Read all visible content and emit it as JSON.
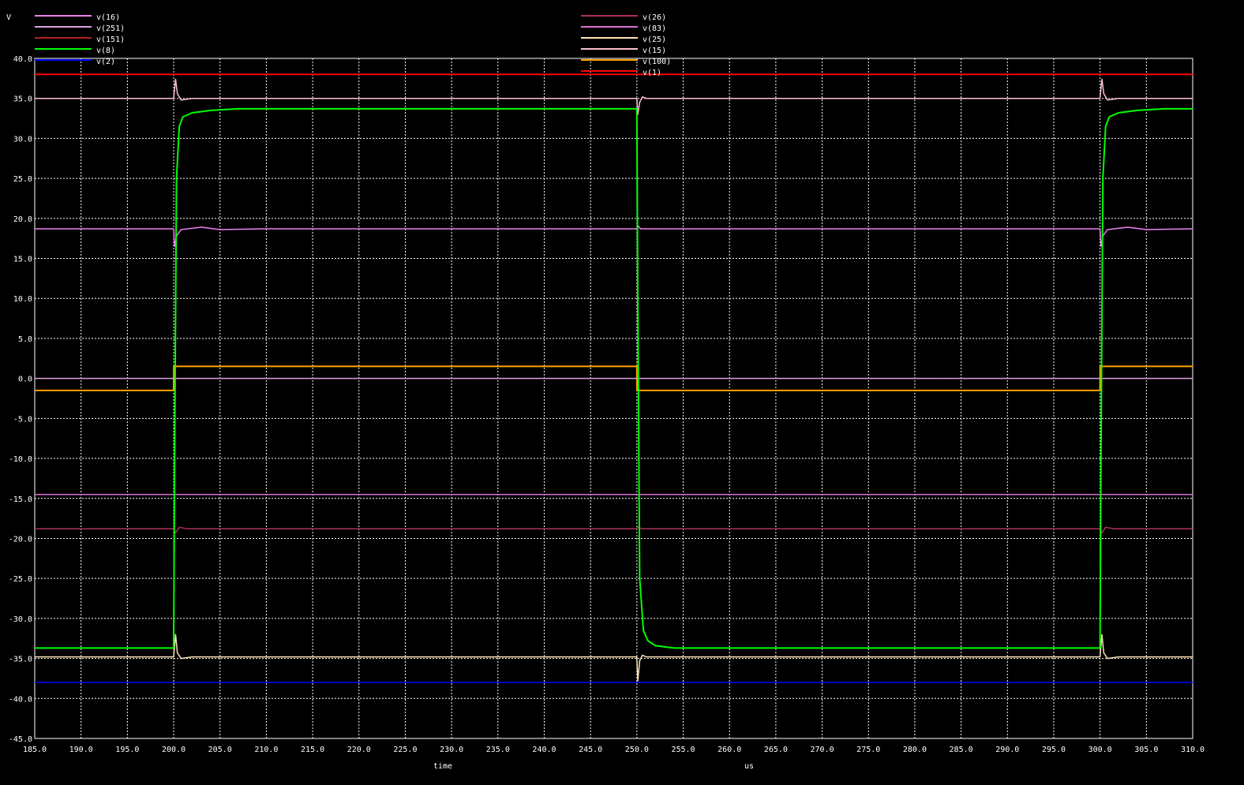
{
  "chart_data": {
    "type": "line",
    "title": "",
    "xlabel": "time",
    "xunit": "us",
    "ylabel": "V",
    "xlim": [
      185,
      310
    ],
    "ylim": [
      -45,
      40
    ],
    "x_ticks": [
      185,
      190,
      195,
      200,
      205,
      210,
      215,
      220,
      225,
      230,
      235,
      240,
      245,
      250,
      255,
      260,
      265,
      270,
      275,
      280,
      285,
      290,
      295,
      300,
      305,
      310
    ],
    "y_ticks": [
      40,
      35,
      30,
      25,
      20,
      15,
      10,
      5,
      0,
      -5,
      -10,
      -15,
      -20,
      -25,
      -30,
      -35,
      -40,
      -45
    ],
    "x_tick_labels": [
      "185.0",
      "190.0",
      "195.0",
      "200.0",
      "205.0",
      "210.0",
      "215.0",
      "220.0",
      "225.0",
      "230.0",
      "235.0",
      "240.0",
      "245.0",
      "250.0",
      "255.0",
      "260.0",
      "265.0",
      "270.0",
      "275.0",
      "280.0",
      "285.0",
      "290.0",
      "295.0",
      "300.0",
      "305.0",
      "310.0"
    ],
    "y_tick_labels": [
      "40.0",
      "35.0",
      "30.0",
      "25.0",
      "20.0",
      "15.0",
      "10.0",
      "5.0",
      "0.0",
      "-5.0",
      "-10.0",
      "-15.0",
      "-20.0",
      "-25.0",
      "-30.0",
      "-35.0",
      "-40.0",
      "-45.0"
    ],
    "grid": true,
    "background": "#000000",
    "grid_color": "#ffffff",
    "legend_left": [
      {
        "name": "v(16)",
        "color": "#ee82ee"
      },
      {
        "name": "v(251)",
        "color": "#dda0dd"
      },
      {
        "name": "v(151)",
        "color": "#b22222"
      },
      {
        "name": "v(8)",
        "color": "#00ff00"
      },
      {
        "name": "v(2)",
        "color": "#0000ff"
      }
    ],
    "legend_right": [
      {
        "name": "v(26)",
        "color": "#b03060"
      },
      {
        "name": "v(83)",
        "color": "#da70d6"
      },
      {
        "name": "v(25)",
        "color": "#ffe4b5"
      },
      {
        "name": "v(15)",
        "color": "#ffc0cb"
      },
      {
        "name": "v(100)",
        "color": "#ffa500"
      },
      {
        "name": "v(1)",
        "color": "#ff0000"
      }
    ],
    "series": [
      {
        "name": "v(1)",
        "color": "#ff0000",
        "x": [
          185,
          310
        ],
        "y": [
          38,
          38
        ]
      },
      {
        "name": "v(2)",
        "color": "#0000ff",
        "x": [
          185,
          310
        ],
        "y": [
          -38,
          -38
        ]
      },
      {
        "name": "v(83)",
        "color": "#da70d6",
        "x": [
          185,
          310
        ],
        "y": [
          -14.5,
          -14.5
        ]
      },
      {
        "name": "v(26)",
        "color": "#b03060",
        "x": [
          185,
          200,
          200.2,
          200.6,
          201.5,
          250,
          250.1,
          250.6,
          300,
          300.2,
          300.6,
          301.5,
          310
        ],
        "y": [
          -18.8,
          -18.8,
          -19.3,
          -18.6,
          -18.8,
          -18.8,
          -18.6,
          -18.8,
          -18.8,
          -19.3,
          -18.6,
          -18.8,
          -18.8
        ]
      },
      {
        "name": "v(16)",
        "color": "#ee82ee",
        "x": [
          185,
          200,
          200.1,
          200.3,
          200.8,
          203,
          205,
          210,
          250,
          250.1,
          250.4,
          300,
          300.1,
          300.3,
          300.8,
          303,
          305,
          310
        ],
        "y": [
          18.7,
          18.7,
          16.5,
          17.8,
          18.6,
          18.9,
          18.6,
          18.7,
          18.7,
          19.1,
          18.7,
          18.7,
          16.5,
          17.8,
          18.6,
          18.9,
          18.6,
          18.7
        ]
      },
      {
        "name": "v(15)",
        "color": "#ffc0cb",
        "x": [
          185,
          200,
          200.2,
          200.4,
          200.8,
          202,
          205,
          250,
          250.1,
          250.3,
          250.6,
          251,
          300,
          300.2,
          300.4,
          300.8,
          302,
          305,
          310
        ],
        "y": [
          35,
          35,
          37.4,
          35.6,
          34.8,
          35,
          35,
          35,
          33,
          34.5,
          35.2,
          35,
          35,
          37.4,
          35.6,
          34.8,
          35,
          35,
          35
        ]
      },
      {
        "name": "v(100)",
        "color": "#ffa500",
        "x": [
          185,
          200,
          200.01,
          250,
          250.01,
          300,
          300.01,
          310
        ],
        "y": [
          -1.5,
          -1.5,
          1.5,
          1.5,
          -1.5,
          -1.5,
          1.5,
          1.5
        ]
      },
      {
        "name": "v(251)",
        "color": "#dda0dd",
        "x": [
          185,
          310
        ],
        "y": [
          0,
          0
        ]
      },
      {
        "name": "v(25)",
        "color": "#ffe4b5",
        "x": [
          185,
          200,
          200.2,
          200.4,
          200.8,
          202,
          205,
          250,
          250.1,
          250.3,
          250.6,
          251,
          300,
          300.2,
          300.4,
          300.8,
          302,
          305,
          310
        ],
        "y": [
          -34.8,
          -34.8,
          -32,
          -34.3,
          -35,
          -34.8,
          -34.8,
          -34.8,
          -37.8,
          -35.3,
          -34.6,
          -34.8,
          -34.8,
          -32,
          -34.3,
          -35,
          -34.8,
          -34.8,
          -34.8
        ]
      },
      {
        "name": "v(8)",
        "color": "#00ff00",
        "x": [
          185,
          200,
          200.1,
          200.3,
          200.6,
          201,
          202,
          204,
          207,
          250,
          250.1,
          250.3,
          250.7,
          251.2,
          252,
          254,
          300,
          300.1,
          300.3,
          300.6,
          301,
          302,
          304,
          307,
          310
        ],
        "y": [
          -33.7,
          -33.7,
          -10,
          25,
          31.5,
          32.7,
          33.2,
          33.5,
          33.7,
          33.7,
          10,
          -25,
          -31.5,
          -32.8,
          -33.4,
          -33.7,
          -33.7,
          -10,
          25,
          31.5,
          32.7,
          33.2,
          33.5,
          33.7,
          33.7
        ]
      }
    ]
  }
}
